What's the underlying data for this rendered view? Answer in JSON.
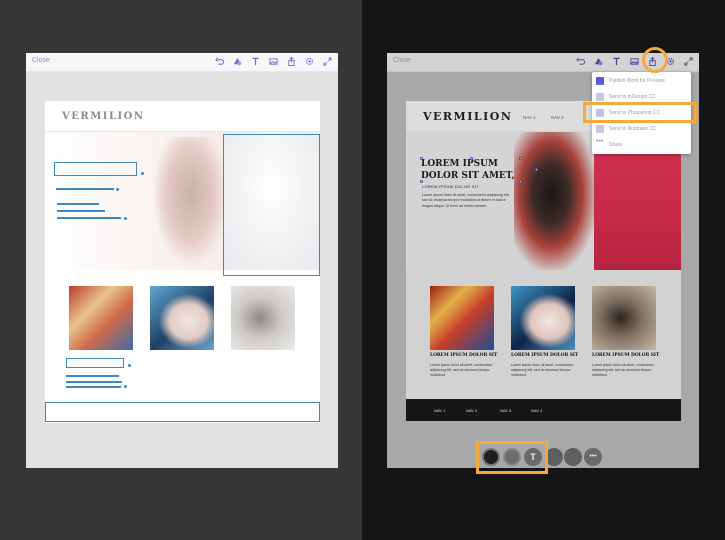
{
  "colors": {
    "accent": "#f6a93b",
    "wireframe": "#3c88c4",
    "hero_red": "#cf3050",
    "toolbar_text": "#8a8fb8"
  },
  "left_panel": {
    "toolbar": {
      "close_label": "Close",
      "icons": [
        "undo-icon",
        "shapes-icon",
        "text-icon",
        "image-icon",
        "share-icon",
        "settings-icon",
        "fullscreen-icon"
      ]
    },
    "page": {
      "logo": "VERMILION"
    }
  },
  "right_panel": {
    "toolbar": {
      "close_label": "Close",
      "icons": [
        "undo-icon",
        "shapes-icon",
        "text-icon",
        "image-icon",
        "share-icon",
        "settings-icon",
        "fullscreen-icon"
      ]
    },
    "page": {
      "logo": "VERMILION",
      "nav": [
        "NAV 1",
        "NAV 2"
      ],
      "hero": {
        "title": "LOREM IPSUM DOLOR SIT AMET,",
        "subtitle": "LOREM IPSUM DOLOR SIT",
        "body": "Lorem ipsum dolor sit amet, consectetur adipiscing elit, sed do eiusmod tempor incididunt ut labore et dolore magna aliqua. Ut enim ad minim veniam."
      },
      "cards": [
        {
          "title": "LOREM IPSUM DOLOR SIT",
          "body": "Lorem ipsum dolor sit amet, consectetur adipiscing elit, sed do eiusmod tempor incididunt"
        },
        {
          "title": "LOREM IPSUM DOLOR SIT",
          "body": "Lorem ipsum dolor sit amet, consectetur adipiscing elit, sed do eiusmod tempor incididunt"
        },
        {
          "title": "LOREM IPSUM DOLOR SIT",
          "body": "Lorem ipsum dolor sit amet, consectetur adipiscing elit, sed do eiusmod tempor incididunt"
        }
      ],
      "footer_nav": [
        "NAV 1",
        "NAV 2",
        "NAV 3",
        "NAV 4"
      ]
    },
    "share_menu": [
      {
        "label": "Publish Work for Preview",
        "icon": "publish-icon",
        "color": "#5b5bd6"
      },
      {
        "label": "Send to InDesign CC",
        "icon": "indesign-icon",
        "color": "#c7c7dd"
      },
      {
        "label": "Send to Photoshop CC",
        "icon": "photoshop-icon",
        "color": "#b9c3dd"
      },
      {
        "label": "Send to Illustrator CC",
        "icon": "illustrator-icon",
        "color": "#c7c7dd"
      },
      {
        "label": "Share",
        "icon": "more-icon",
        "color": "#9a9ab2"
      }
    ],
    "dock": [
      "fill-color-swatch",
      "stroke-swatch",
      "text-icon",
      "layers-icon",
      "trash-icon",
      "more-icon"
    ]
  }
}
